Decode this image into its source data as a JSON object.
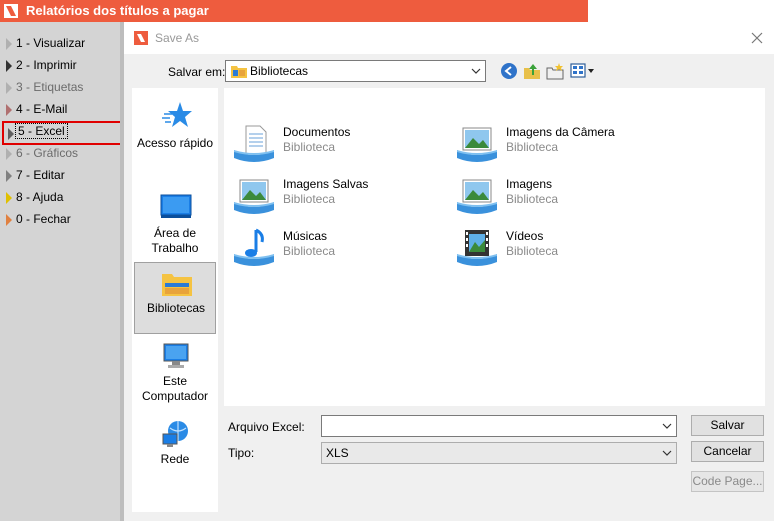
{
  "app": {
    "title": "Relatórios dos títulos a pagar",
    "menu": [
      {
        "label": "1 - Visualizar",
        "color": "#b0b0b0",
        "selected": false
      },
      {
        "label": "2 - Imprimir",
        "color": "#333333",
        "selected": false
      },
      {
        "label": "3 - Etiquetas",
        "color": "#b0b0b0",
        "selected": false
      },
      {
        "label": "4 - E-Mail",
        "color": "#b07070",
        "selected": false
      },
      {
        "label": "5 - Excel",
        "color": "#606060",
        "selected": true
      },
      {
        "label": "6 - Gráficos",
        "color": "#b0b0b0",
        "selected": false
      },
      {
        "label": "7 - Editar",
        "color": "#808080",
        "selected": false
      },
      {
        "label": "8 - Ajuda",
        "color": "#e0c000",
        "selected": false
      },
      {
        "label": "0 - Fechar",
        "color": "#e08040",
        "selected": false
      }
    ]
  },
  "dialog": {
    "title": "Save As",
    "save_in_label": "Salvar em:",
    "save_in_value": "Bibliotecas",
    "places": [
      {
        "label": "Acesso rápido",
        "icon": "star-icon"
      },
      {
        "label": "Área de Trabalho",
        "icon": "desktop-icon"
      },
      {
        "label": "Bibliotecas",
        "icon": "libraries-icon"
      },
      {
        "label": "Este Computador",
        "icon": "computer-icon"
      },
      {
        "label": "Rede",
        "icon": "network-icon"
      }
    ],
    "items": [
      {
        "name": "Documentos",
        "type": "Biblioteca",
        "icon": "documents-icon"
      },
      {
        "name": "Imagens da Câmera",
        "type": "Biblioteca",
        "icon": "camera-roll-icon"
      },
      {
        "name": "Imagens Salvas",
        "type": "Biblioteca",
        "icon": "saved-pictures-icon"
      },
      {
        "name": "Imagens",
        "type": "Biblioteca",
        "icon": "pictures-icon"
      },
      {
        "name": "Músicas",
        "type": "Biblioteca",
        "icon": "music-icon"
      },
      {
        "name": "Vídeos",
        "type": "Biblioteca",
        "icon": "videos-icon"
      }
    ],
    "filename_label": "Arquivo Excel:",
    "filename_value": "",
    "type_label": "Tipo:",
    "type_value": "XLS",
    "save_button": "Salvar",
    "cancel_button": "Cancelar",
    "codepage_button": "Code Page..."
  }
}
